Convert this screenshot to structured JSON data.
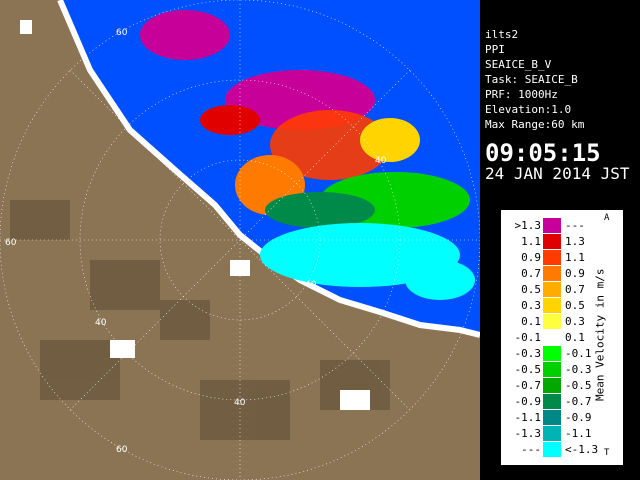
{
  "info": {
    "lines": [
      "ilts2",
      "PPI",
      "SEAICE_B_V",
      "Task: SEAICE_B",
      "PRF: 1000Hz",
      "Elevation:1.0",
      "Max Range:60 km"
    ],
    "time": "09:05:15",
    "date": "24 JAN 2014 JST"
  },
  "ring_labels": [
    "60",
    "40",
    "60",
    "40",
    "40",
    "40",
    "60"
  ],
  "legend": {
    "rows": [
      {
        "lo": ">1.3",
        "hi": "---",
        "color": "#c8009a"
      },
      {
        "lo": "1.1",
        "hi": "1.3",
        "color": "#e00000"
      },
      {
        "lo": "0.9",
        "hi": "1.1",
        "color": "#ff3b00"
      },
      {
        "lo": "0.7",
        "hi": "0.9",
        "color": "#ff7a00"
      },
      {
        "lo": "0.5",
        "hi": "0.7",
        "color": "#ffab00"
      },
      {
        "lo": "0.3",
        "hi": "0.5",
        "color": "#ffd400"
      },
      {
        "lo": "0.1",
        "hi": "0.3",
        "color": "#ffff40"
      },
      {
        "lo": "-0.1",
        "hi": "0.1",
        "color": "#ffffff"
      },
      {
        "lo": "-0.3",
        "hi": "-0.1",
        "color": "#00ff00"
      },
      {
        "lo": "-0.5",
        "hi": "-0.3",
        "color": "#00d000"
      },
      {
        "lo": "-0.7",
        "hi": "-0.5",
        "color": "#00a800"
      },
      {
        "lo": "-0.9",
        "hi": "-0.7",
        "color": "#008a4a"
      },
      {
        "lo": "-1.1",
        "hi": "-0.9",
        "color": "#008888"
      },
      {
        "lo": "-1.3",
        "hi": "-1.1",
        "color": "#00b4b4"
      },
      {
        "lo": "---",
        "hi": "<-1.3",
        "color": "#00ffff"
      }
    ],
    "unit": "Mean Velocity in m/s",
    "top_mark": "A",
    "bottom_mark": "T"
  },
  "colors": {
    "sea": "#0050ff",
    "land": "#8a7454",
    "background": "#000000"
  }
}
